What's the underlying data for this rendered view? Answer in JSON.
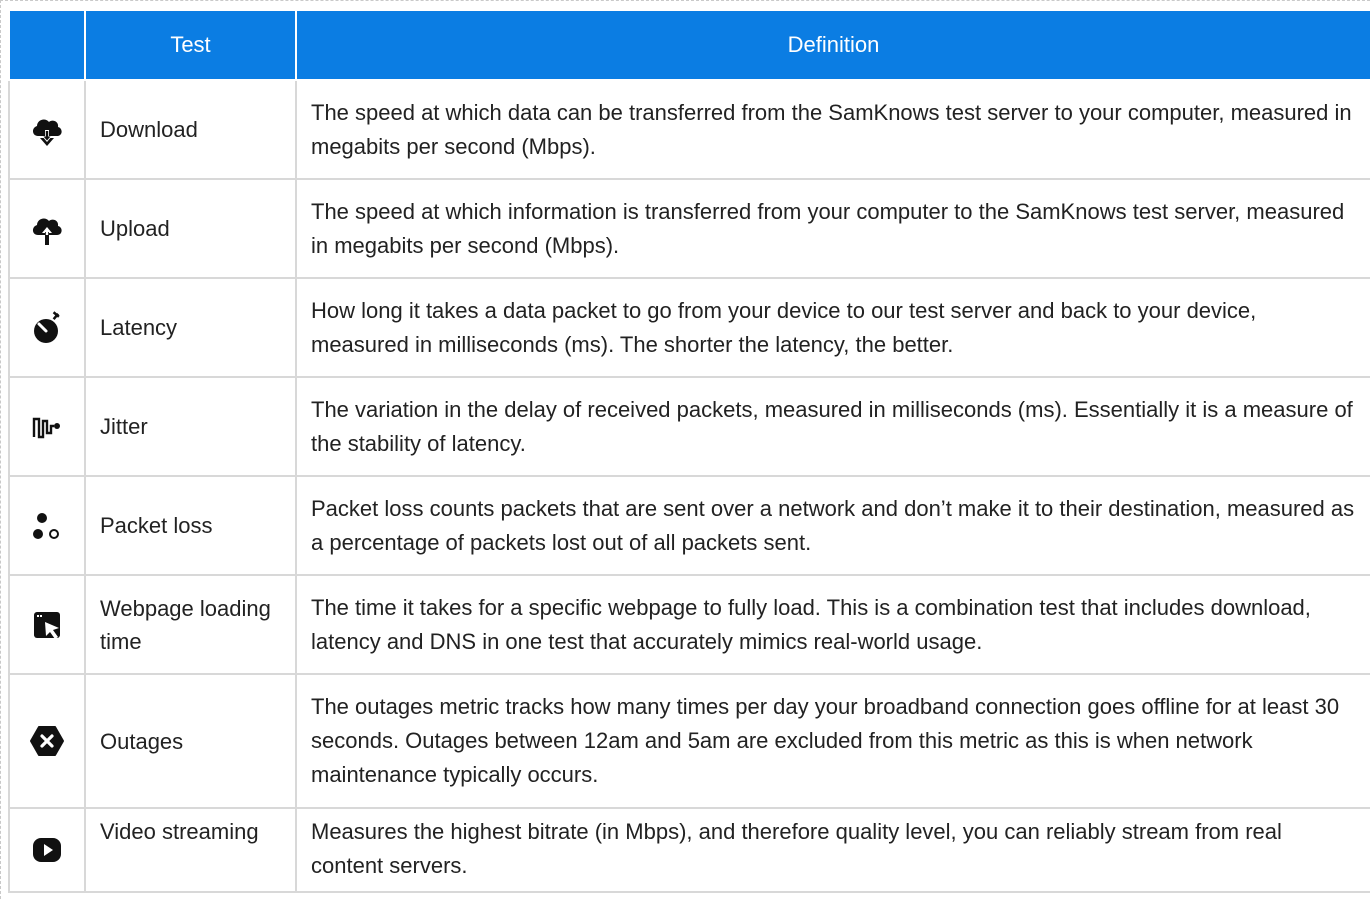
{
  "table": {
    "headers": {
      "icon": "",
      "test": "Test",
      "definition": "Definition"
    },
    "rows": [
      {
        "icon": "cloud-download-icon",
        "test": "Download",
        "definition": "The speed at which data can be transferred from the SamKnows test server to your computer, measured in megabits per second (Mbps)."
      },
      {
        "icon": "cloud-upload-icon",
        "test": "Upload",
        "definition": "The speed at which information is transferred from your computer to the SamKnows test server, measured in megabits per second (Mbps)."
      },
      {
        "icon": "stopwatch-icon",
        "test": "Latency",
        "definition": "How long it takes a data packet to go from your device to our test server and back to your device, measured in milliseconds (ms). The shorter the latency, the better."
      },
      {
        "icon": "jitter-wave-icon",
        "test": "Jitter",
        "definition": "The variation in the delay of received packets, measured in milliseconds (ms). Essentially it is a measure of the stability of latency."
      },
      {
        "icon": "packet-loss-icon",
        "test": "Packet loss",
        "definition": "Packet loss counts packets that are sent over a network and don’t make it to their destination, measured as a percentage of packets lost out of all packets sent."
      },
      {
        "icon": "browser-cursor-icon",
        "test": "Webpage loading time",
        "definition": "The time it takes for a specific webpage to fully load. This is a combination test that includes download, latency and DNS in one test that accurately mimics real-world usage."
      },
      {
        "icon": "hexagon-x-icon",
        "test": "Outages",
        "definition": "The outages metric tracks how many times per day your broadband connection goes offline for at least 30 seconds. Outages between 12am and 5am are excluded from this metric as this is when network maintenance typically occurs."
      },
      {
        "icon": "video-play-icon",
        "test": "Video streaming",
        "definition": "Measures the highest bitrate (in Mbps), and therefore quality level, you can reliably stream from real content servers."
      }
    ]
  },
  "colors": {
    "header_bg": "#0b7de3",
    "header_text": "#ffffff",
    "border": "#d8d8d8",
    "icon": "#111111"
  }
}
